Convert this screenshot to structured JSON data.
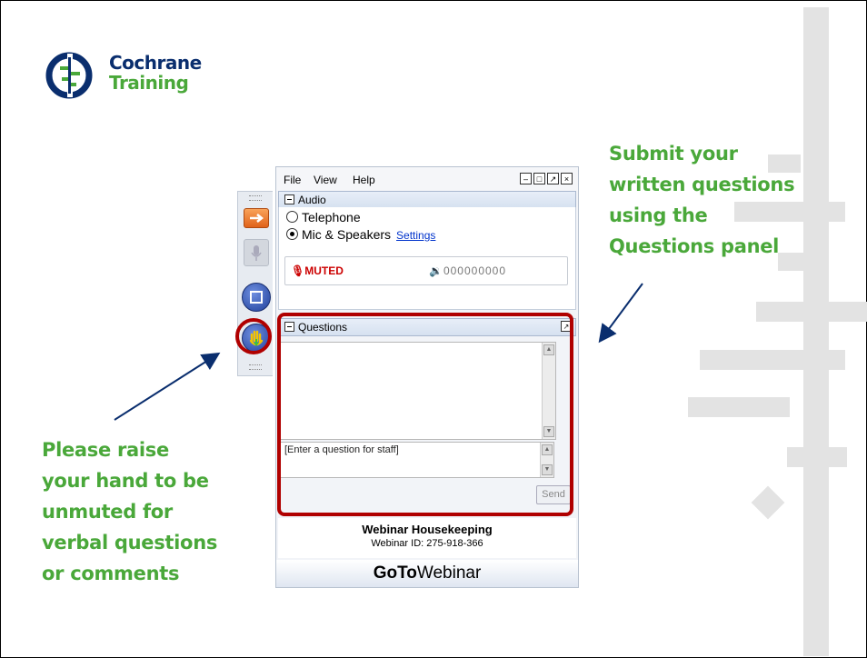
{
  "logo": {
    "line1": "Cochrane",
    "line2": "Training",
    "icon": "cochrane-logo-icon"
  },
  "callouts": {
    "right": [
      "Submit your",
      "written questions",
      "using the",
      "Questions panel"
    ],
    "left": [
      "Please raise",
      "your hand to be",
      "unmuted for",
      "verbal questions",
      "or comments"
    ]
  },
  "window": {
    "menu": [
      "File",
      "View",
      "Help"
    ],
    "audio": {
      "header": "Audio",
      "option_telephone": "Telephone",
      "option_mic": "Mic & Speakers",
      "settings_link": "Settings",
      "muted_label": "MUTED",
      "volume_meter": "000000000",
      "selected": "Mic & Speakers"
    },
    "questions": {
      "header": "Questions",
      "input_placeholder": "[Enter a question for staff]",
      "send_label": "Send"
    },
    "info": {
      "title": "Webinar Housekeeping",
      "webinar_id": "Webinar ID: 275-918-366"
    },
    "footer": {
      "brand_bold": "GoTo",
      "brand_rest": "Webinar"
    }
  },
  "colors": {
    "accent_green": "#4aa83a",
    "navy": "#0a2e6e",
    "highlight_red": "#b00000",
    "muted_red": "#cc0000"
  }
}
